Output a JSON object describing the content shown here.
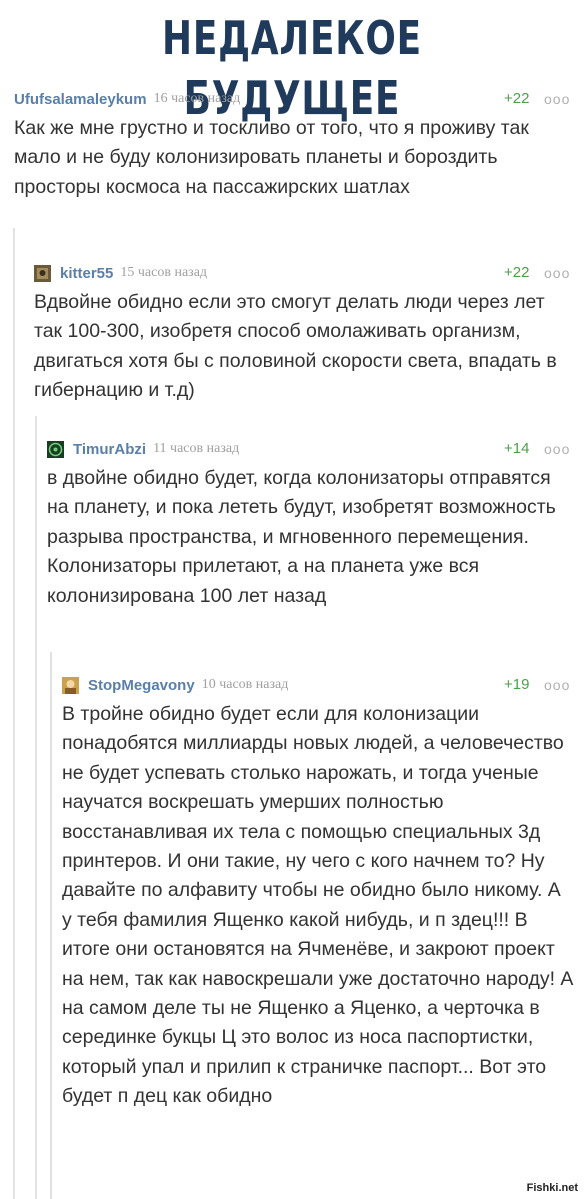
{
  "header": {
    "title": "НЕДАЛЕКОЕ БУДУЩЕЕ"
  },
  "comments": [
    {
      "user": "Ufufsalamaleykum",
      "time": "16 часов назад",
      "rating": "+22",
      "menu": "ooo",
      "text": "Как же мне грустно и тоскливо от того, что я проживу так мало и не буду колонизировать планеты и бороздить просторы космоса на пассажирских шатлах"
    },
    {
      "user": "kitter55",
      "time": "15 часов назад",
      "rating": "+22",
      "menu": "ooo",
      "text": "Вдвойне обидно если это смогут делать люди через лет так 100-300, изобретя способ омолаживать организм, двигаться хотя бы с половиной скорости света, впадать в гибернацию и т.д)"
    },
    {
      "user": "TimurAbzi",
      "time": "11 часов назад",
      "rating": "+14",
      "menu": "ooo",
      "text": "в двойне обидно будет, когда колонизаторы отправятся на планету, и пока лететь будут, изобретят возможность разрыва пространства, и мгновенного перемещения. Колонизаторы прилетают, а на планета уже вся колонизирована 100 лет назад"
    },
    {
      "user": "StopMegavony",
      "time": "10 часов назад",
      "rating": "+19",
      "menu": "ooo",
      "text": "В тройне обидно будет если для колонизации понадобятся миллиарды новых людей, а человечество не будет успевать столько нарожать, и тогда ученые научатся воскрешать умерших полностью восстанавливая их тела с помощью специальных 3д принтеров. И они такие, ну чего с кого начнем то? Ну давайте по алфавиту чтобы не обидно было никому. А у тебя фамилия Ященко какой нибудь, и п здец!!! В итоге они остановятся на Ячменёве, и закроют проект на нем, так как навоскрешали уже достаточно народу! А на самом деле ты не Ященко а Яценко, а черточка в серединке букцы Ц это волос из носа паспортистки, который упал и прилип к страничке паспорт... Вот это будет п дец как обидно"
    }
  ],
  "watermark": "Fishki.net"
}
